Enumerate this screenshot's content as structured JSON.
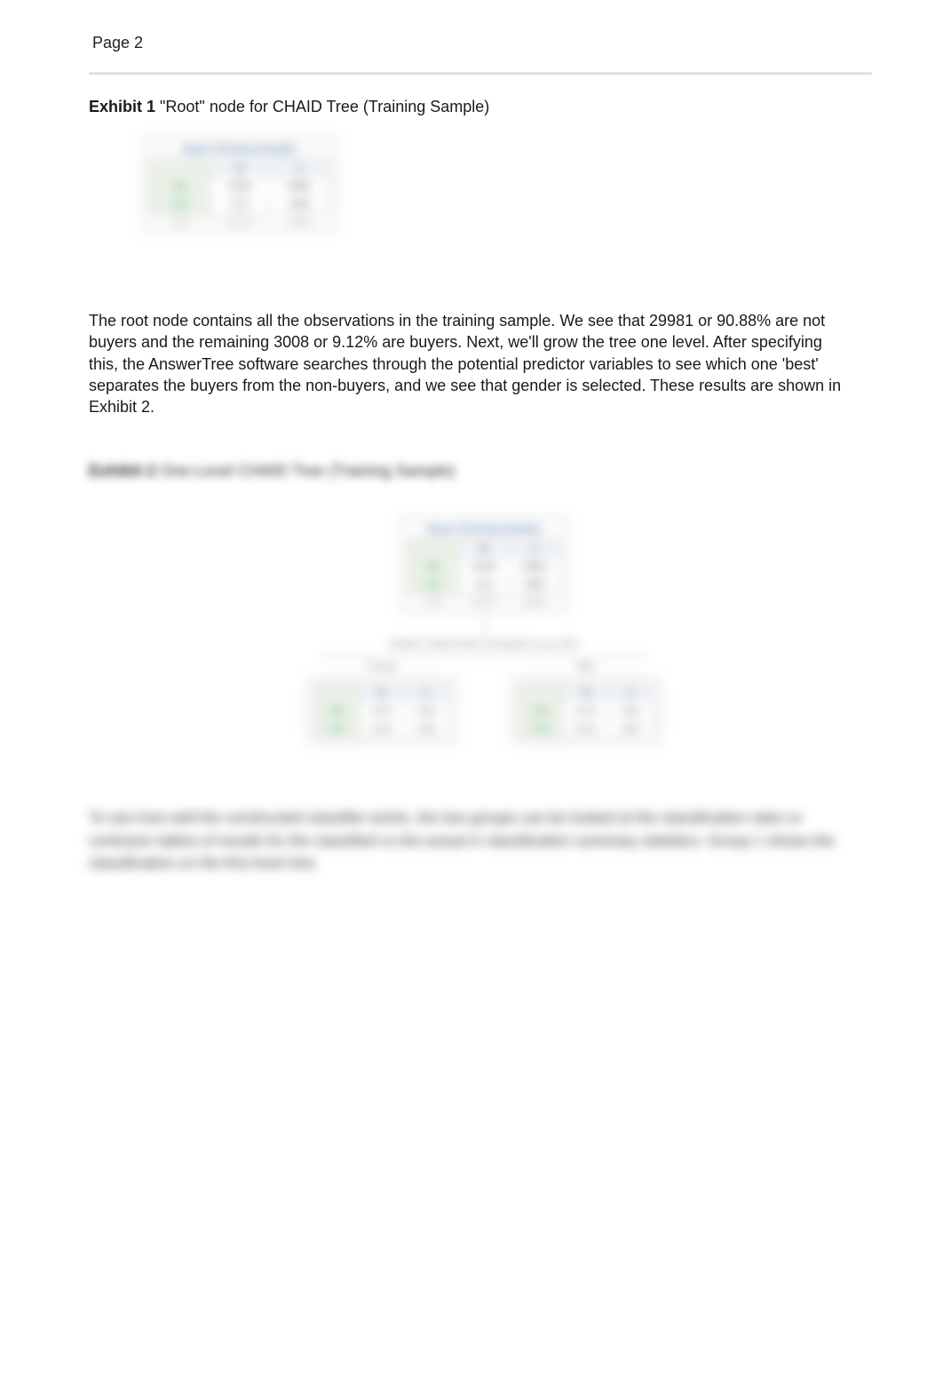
{
  "page_label": "Page 2",
  "exhibit1": {
    "label_bold": "Exhibit 1",
    "label_rest": " \"Root\" node for CHAID Tree (Training Sample)"
  },
  "root_node": {
    "title": "Buyer (Training Sample)",
    "col1": "%",
    "col2": "n",
    "r1_cat": "No",
    "r1_pct": "90.88",
    "r1_n": "29981",
    "r2_cat": "Yes",
    "r2_pct": "9.12",
    "r2_n": "3008",
    "foot1": "Total",
    "foot2": "100.00",
    "foot3": "32989"
  },
  "paragraph": "The root node contains all the observations in the training sample. We see that 29981 or 90.88% are not buyers and the remaining 3008 or 9.12% are buyers. Next, we'll grow the tree one level. After specifying this, the AnswerTree software searches through the potential predictor variables to see which one 'best' separates the buyers from the non-buyers, and we see that gender is selected. These results are shown in Exhibit 2.",
  "exhibit2": {
    "label_bold": "Exhibit 2",
    "label_rest": " One-Level CHAID Tree (Training Sample)"
  },
  "split_label": "Gender\nP-value=0.000, Chi-square=xx.xxx, df=1",
  "child_left": {
    "label": "Female",
    "r1_cat": "No",
    "r1_pct": "xx.xx",
    "r1_n": "xxxx",
    "r2_cat": "Yes",
    "r2_pct": "xx.xx",
    "r2_n": "xxxx"
  },
  "child_right": {
    "label": "Male",
    "r1_cat": "No",
    "r1_pct": "xx.xx",
    "r1_n": "xxxx",
    "r2_cat": "Yes",
    "r2_pct": "xx.xx",
    "r2_n": "xxxx"
  },
  "blurred_text_hint": "To see how well the constructed classifier works, the two groups can be looked at the classification rates or confusion tables of results for the classified vs the actual in classification summary statistics. Group 1 shows the classification on the first level tree."
}
